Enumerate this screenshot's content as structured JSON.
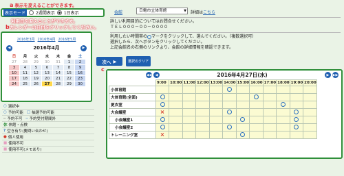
{
  "annotations": {
    "a_letter": "a",
    "a_text": "表示を変えることができます。",
    "b_letter": "b",
    "b_text1": "利用日を変えることができます。",
    "b_text2": "カレンダーの日付をクリックしてください。",
    "c_letter": "c"
  },
  "display_mode": {
    "label": "表示モード",
    "option_week": "2週間表示",
    "option_day": "1日表示",
    "selected": "1日表示"
  },
  "month_links": [
    "2016年3月",
    "2016年4月",
    "2016年5月"
  ],
  "calendar": {
    "title": "2016年4月",
    "weekdays": [
      "日",
      "月",
      "火",
      "水",
      "木",
      "金",
      "土"
    ],
    "rows": [
      [
        "27",
        "28",
        "29",
        "30",
        "31",
        "1",
        "2"
      ],
      [
        "3",
        "4",
        "5",
        "6",
        "7",
        "8",
        "9"
      ],
      [
        "10",
        "11",
        "12",
        "13",
        "14",
        "15",
        "16"
      ],
      [
        "17",
        "18",
        "19",
        "20",
        "21",
        "22",
        "23"
      ],
      [
        "24",
        "25",
        "26",
        "27",
        "28",
        "29",
        "30"
      ]
    ]
  },
  "legend": [
    {
      "icon": "○",
      "label": "選択中"
    },
    {
      "icon": "○",
      "label": "予約可能",
      "icon2": "□",
      "label2": "抽選予約可能"
    },
    {
      "icon": "─",
      "label": "予約不可",
      "icon2": "─",
      "label2": "予約受付期間外"
    },
    {
      "icon": "休",
      "label": "休館・点検"
    },
    {
      "icon": "?",
      "label": "空き有り(要問い合わせ)"
    },
    {
      "icon": "●",
      "label": "個人使用"
    },
    {
      "icon": "■",
      "label": "使用不可"
    },
    {
      "icon": "■",
      "label": "使用不可(メモあり)"
    }
  ],
  "facility": {
    "link": "会館",
    "select_value": "日電市立体育館",
    "detail_prefix": "詳細は",
    "detail_link": "こちら",
    "note1": "詳しい利用目的についてはお問合せください。",
    "note2": "ＴＥＬ０００－００－００００",
    "instr1": "利用したい時間帯の",
    "instr1b": "マークをクリックして、選んでください。（複数選択可）",
    "instr2": "選択したら、次へボタンをクリックしてください。",
    "instr3": "上記会館名の右側のリンクより、会館の詳細情報を確認できます。"
  },
  "buttons": {
    "next": "次へ",
    "clear": "選択のクリア"
  },
  "schedule": {
    "date_title": "2016年4月27日(水)",
    "times": [
      "9:00",
      "10:00",
      "11:00",
      "12:00",
      "13:00",
      "14:00",
      "15:00",
      "16:00",
      "17:00",
      "18:00",
      "19:00",
      "20:00"
    ],
    "rooms": [
      {
        "name": "小体育館",
        "sub": false,
        "marks": [
          "",
          "",
          "",
          "",
          "",
          "○",
          "",
          "",
          "",
          "",
          "",
          ""
        ]
      },
      {
        "name": "大体育館(全面)",
        "sub": false,
        "marks": [
          "○",
          "",
          "",
          "",
          "",
          "",
          "",
          "○",
          "",
          "",
          "",
          ""
        ]
      },
      {
        "name": "更衣室",
        "sub": false,
        "marks": [
          "○",
          "",
          "",
          "",
          "",
          "",
          "",
          "",
          "",
          "○",
          "",
          ""
        ]
      },
      {
        "name": "大会議室",
        "sub": false,
        "marks": [
          "×",
          "",
          "",
          "",
          "",
          "○",
          "",
          "",
          "",
          "",
          "○",
          ""
        ]
      },
      {
        "name": "小会議室1",
        "sub": true,
        "marks": [
          "○",
          "",
          "",
          "",
          "",
          "",
          "○",
          "",
          "",
          "",
          "○",
          ""
        ]
      },
      {
        "name": "小会議室2",
        "sub": true,
        "marks": [
          "○",
          "",
          "",
          "",
          "",
          "○",
          "",
          "",
          "",
          "",
          "○",
          ""
        ]
      },
      {
        "name": "トレーニング室",
        "sub": false,
        "marks": [
          "×",
          "",
          "",
          "",
          "",
          "",
          "○",
          "",
          "",
          "",
          "",
          ""
        ]
      }
    ]
  },
  "colors": {
    "accent_green": "#2f8f3a",
    "annotation_red": "#e0303a",
    "nav_blue": "#1f5fb0",
    "slot_yellow": "#fbfbd2"
  }
}
